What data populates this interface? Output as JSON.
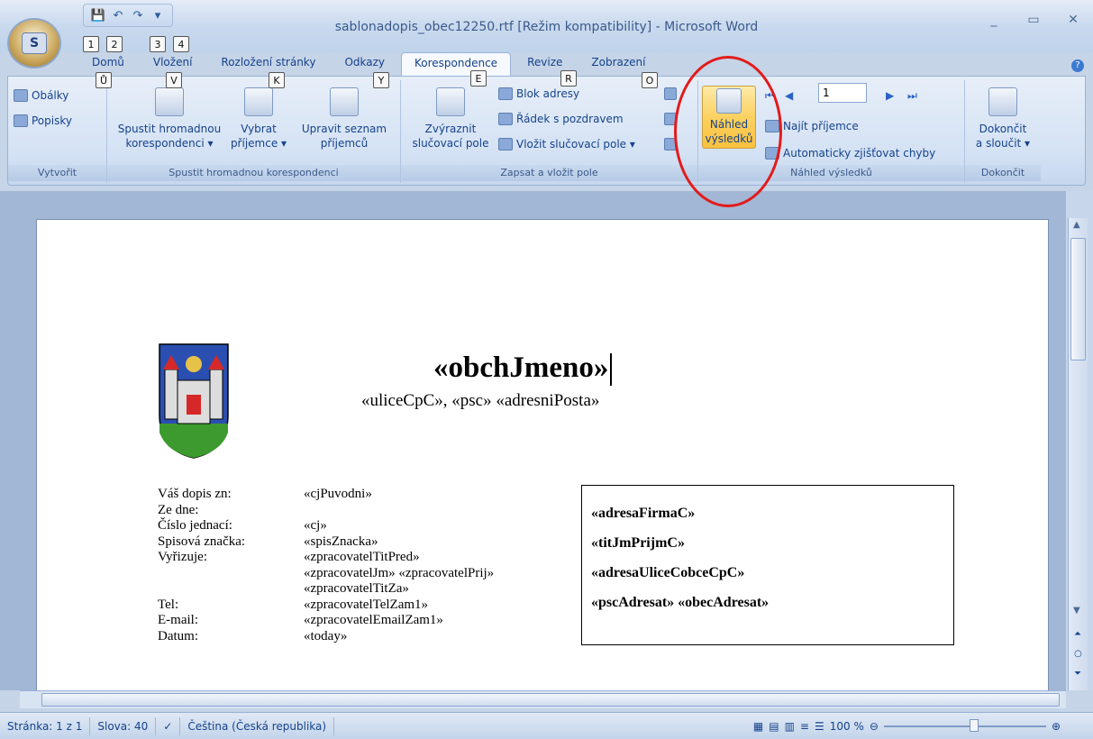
{
  "window": {
    "title": "sablonadopis_obec12250.rtf [Režim kompatibility] - Microsoft Word",
    "controls": [
      "_",
      "▭",
      "✕"
    ]
  },
  "office_button": {
    "label": "S"
  },
  "quick_access": {
    "keytips": [
      "1",
      "2",
      "3",
      "4"
    ]
  },
  "tabs": [
    {
      "label": "Domů",
      "keytip": "Ů"
    },
    {
      "label": "Vložení",
      "keytip": "V"
    },
    {
      "label": "Rozložení stránky",
      "keytip": "K"
    },
    {
      "label": "Odkazy",
      "keytip": "Y"
    },
    {
      "label": "Korespondence",
      "keytip": "E"
    },
    {
      "label": "Revize",
      "keytip": "R"
    },
    {
      "label": "Zobrazení",
      "keytip": "O"
    }
  ],
  "ribbon": {
    "vytvorit": {
      "label": "Vytvořit",
      "items": [
        "Obálky",
        "Popisky"
      ]
    },
    "spustit": {
      "label": "Spustit hromadnou korespondenci",
      "btn1": [
        "Spustit hromadnou",
        "korespondenci ▾"
      ],
      "btn2": [
        "Vybrat",
        "příjemce ▾"
      ],
      "btn3": [
        "Upravit seznam",
        "příjemců"
      ]
    },
    "zapsat": {
      "label": "Zapsat a vložit pole",
      "big": [
        "Zvýraznit",
        "slučovací pole"
      ],
      "items": [
        "Blok adresy",
        "Řádek s pozdravem",
        "Vložit slučovací pole ▾"
      ]
    },
    "nahled": {
      "label": "Náhled výsledků",
      "big": [
        "Náhled",
        "výsledků"
      ],
      "record": "1",
      "items": [
        "Najít příjemce",
        "Automaticky zjišťovat chyby"
      ]
    },
    "dokoncit": {
      "label": "Dokončit",
      "big": [
        "Dokončit",
        "a sloučit ▾"
      ]
    }
  },
  "document": {
    "obchJmeno": "«obchJmeno»",
    "address_line": "«uliceCpC»,  «psc» «adresniPosta»",
    "info_rows": [
      {
        "label": "Váš dopis zn:",
        "value": "«cjPuvodni»"
      },
      {
        "label": "Ze dne:",
        "value": ""
      },
      {
        "label": "Číslo jednací:",
        "value": "«cj»"
      },
      {
        "label": "Spisová značka:",
        "value": "«spisZnacka»"
      },
      {
        "label": "Vyřizuje:",
        "value": "«zpracovatelTitPred»"
      },
      {
        "label": "",
        "value": "«zpracovatelJm» «zpracovatelPrij»"
      },
      {
        "label": "",
        "value": "«zpracovatelTitZa»"
      },
      {
        "label": "Tel:",
        "value": "«zpracovatelTelZam1»"
      },
      {
        "label": "E-mail:",
        "value": "«zpracovatelEmailZam1»"
      },
      {
        "label": "Datum:",
        "value": "«today»"
      }
    ],
    "recipient": [
      "«adresaFirmaC»",
      "«titJmPrijmC»",
      "«adresaUliceCobceCpC»",
      "«pscAdresat» «obecAdresat»"
    ]
  },
  "status": {
    "page": "Stránka: 1 z 1",
    "words": "Slova: 40",
    "language": "Čeština (Česká republika)",
    "zoom": "100 %"
  }
}
